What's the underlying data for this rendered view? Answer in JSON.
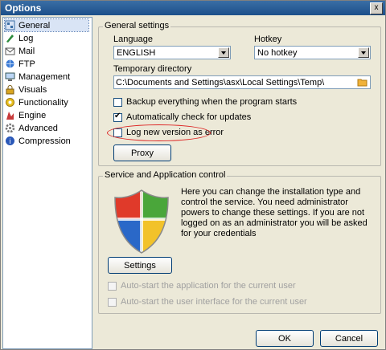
{
  "window": {
    "title": "Options",
    "close_glyph": "x"
  },
  "sidebar": {
    "items": [
      {
        "label": "General",
        "icon": "general-icon",
        "selected": true
      },
      {
        "label": "Log",
        "icon": "log-icon"
      },
      {
        "label": "Mail",
        "icon": "mail-icon"
      },
      {
        "label": "FTP",
        "icon": "ftp-icon"
      },
      {
        "label": "Management",
        "icon": "management-icon"
      },
      {
        "label": "Visuals",
        "icon": "visuals-icon"
      },
      {
        "label": "Functionality",
        "icon": "functionality-icon"
      },
      {
        "label": "Engine",
        "icon": "engine-icon"
      },
      {
        "label": "Advanced",
        "icon": "advanced-icon"
      },
      {
        "label": "Compression",
        "icon": "compression-icon"
      }
    ]
  },
  "general": {
    "group_label": "General settings",
    "language_label": "Language",
    "language_value": "ENGLISH",
    "hotkey_label": "Hotkey",
    "hotkey_value": "No hotkey",
    "tempdir_label": "Temporary directory",
    "tempdir_value": "C:\\Documents and Settings\\asx\\Local Settings\\Temp\\",
    "backup_label": "Backup everything when the program starts",
    "backup_checked": false,
    "autocheck_label": "Automatically check for updates",
    "autocheck_checked": true,
    "lognew_label": "Log new version as error",
    "lognew_checked": false,
    "proxy_label": "Proxy"
  },
  "service": {
    "group_label": "Service and Application control",
    "description": "Here you can change the installation type and control the service. You need administrator powers to change these settings. If you are not logged on as an administrator you will be asked for your credentials",
    "settings_label": "Settings",
    "autostart_app_label": "Auto-start the application for the current user",
    "autostart_ui_label": "Auto-start the user interface for the current user"
  },
  "footer": {
    "ok_label": "OK",
    "cancel_label": "Cancel"
  },
  "colors": {
    "accent": "#3a6ea5",
    "highlight": "#d22222",
    "shield_red": "#e03a2a",
    "shield_green": "#4aa63a",
    "shield_blue": "#2a68c8",
    "shield_yellow": "#f2c22a"
  }
}
